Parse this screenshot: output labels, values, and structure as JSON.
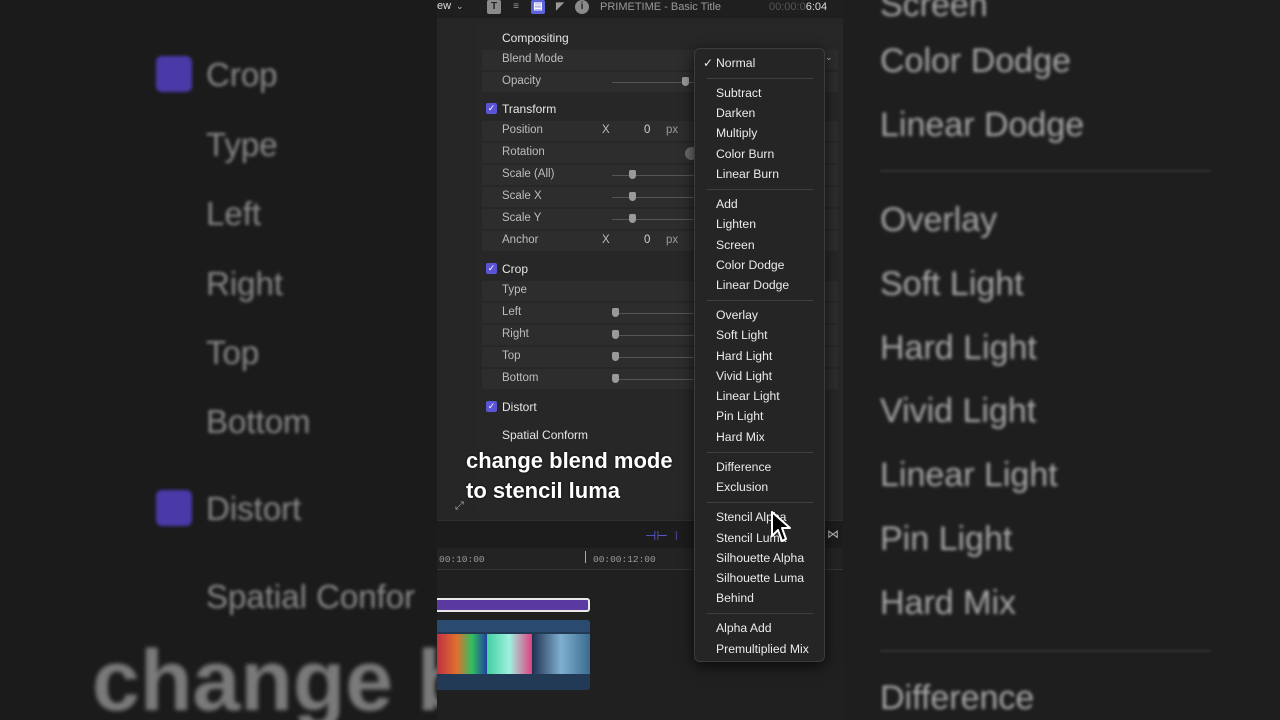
{
  "background_blur": {
    "left_labels": [
      "Crop",
      "Type",
      "Left",
      "Right",
      "Top",
      "Bottom",
      "Distort",
      "Spatial Confor"
    ],
    "right_labels": [
      "Screen",
      "Color Dodge",
      "Linear Dodge",
      "Overlay",
      "Soft Light",
      "Hard Light",
      "Vivid Light",
      "Linear Light",
      "Pin Light",
      "Hard Mix",
      "Difference"
    ],
    "caption_fragment": "change b"
  },
  "toolbar": {
    "view_label": "ew",
    "icons": [
      "text-icon",
      "list-icon",
      "video-inspector-icon",
      "filter-icon",
      "info-icon"
    ],
    "title": "PRIMETIME - Basic Title",
    "time_dim": "00:00:0",
    "time": "6:04"
  },
  "inspector": {
    "compositing": {
      "title": "Compositing",
      "blend_mode_label": "Blend Mode",
      "opacity_label": "Opacity"
    },
    "transform": {
      "title": "Transform",
      "position_label": "Position",
      "position_axis": "X",
      "position_value": "0",
      "position_unit": "px",
      "rotation_label": "Rotation",
      "scale_all_label": "Scale (All)",
      "scale_x_label": "Scale X",
      "scale_y_label": "Scale Y",
      "anchor_label": "Anchor",
      "anchor_axis": "X",
      "anchor_value": "0",
      "anchor_unit": "px"
    },
    "crop": {
      "title": "Crop",
      "type_label": "Type",
      "left_label": "Left",
      "right_label": "Right",
      "top_label": "Top",
      "bottom_label": "Bottom"
    },
    "distort": {
      "title": "Distort"
    },
    "spatial_conform": {
      "label": "Spatial Conform"
    }
  },
  "caption": {
    "line1": "change blend mode",
    "line2": "to stencil luma"
  },
  "timeline": {
    "tc1": "00:10:00",
    "tc2": "00:00:12:00"
  },
  "blend_menu": {
    "selected": "Normal",
    "groups": [
      [
        "Normal"
      ],
      [
        "Subtract",
        "Darken",
        "Multiply",
        "Color Burn",
        "Linear Burn"
      ],
      [
        "Add",
        "Lighten",
        "Screen",
        "Color Dodge",
        "Linear Dodge"
      ],
      [
        "Overlay",
        "Soft Light",
        "Hard Light",
        "Vivid Light",
        "Linear Light",
        "Pin Light",
        "Hard Mix"
      ],
      [
        "Difference",
        "Exclusion"
      ],
      [
        "Stencil Alpha",
        "Stencil Luma",
        "Silhouette Alpha",
        "Silhouette Luma",
        "Behind"
      ],
      [
        "Alpha Add",
        "Premultiplied Mix"
      ]
    ]
  },
  "colors": {
    "accent": "#5b54d6",
    "title_clip": "#5a3aa0",
    "menu_bg": "#252525"
  }
}
